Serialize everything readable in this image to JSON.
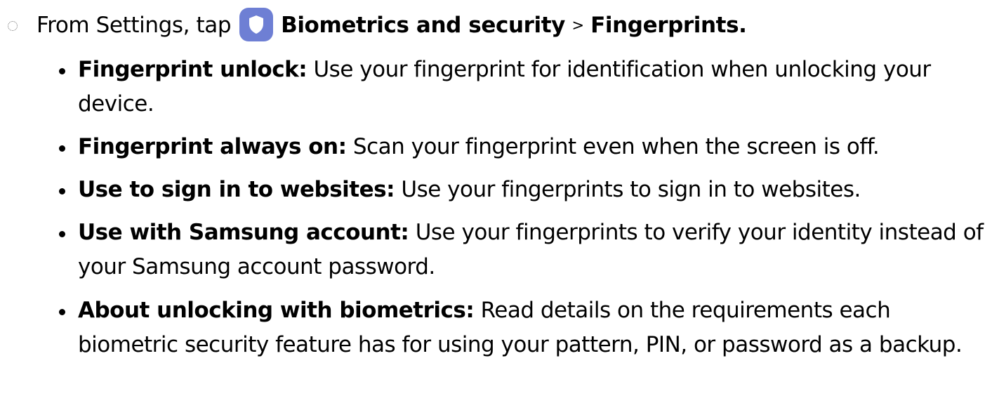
{
  "step": {
    "intro": "From Settings, tap",
    "app_icon": "shield-icon",
    "app_icon_color": "#6e7fd4",
    "menu": "Biometrics and security",
    "separator": ">",
    "submenu": "Fingerprints."
  },
  "items": [
    {
      "term": "Fingerprint unlock:",
      "description": "Use your fingerprint for identification when unlocking your device."
    },
    {
      "term": "Fingerprint always on:",
      "description": "Scan your fingerprint even when the screen is off."
    },
    {
      "term": "Use to sign in to websites:",
      "description": "Use your fingerprints to sign in to websites."
    },
    {
      "term": "Use with Samsung account:",
      "description": "Use your fingerprints to verify your identity instead of your Samsung account password."
    },
    {
      "term": "About unlocking with biometrics:",
      "description": "Read details on the requirements each biometric security feature has for using your pattern, PIN, or password as a backup."
    }
  ]
}
